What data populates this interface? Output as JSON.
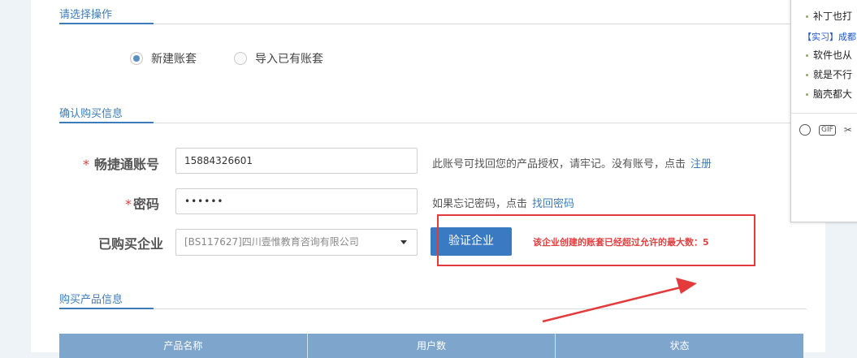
{
  "sections": {
    "select_operation": "请选择操作",
    "confirm_purchase": "确认购买信息",
    "purchase_product": "购买产品信息"
  },
  "radio_options": {
    "new_account_set": "新建账套",
    "import_account_set": "导入已有账套",
    "selected": "新建账套"
  },
  "form": {
    "account_label": "畅捷通账号",
    "account_value": "15884326601",
    "account_hint": "此账号可找回您的产品授权，请牢记。没有账号，点击",
    "account_hint_link": "注册",
    "password_label": "密码",
    "password_value": "••••••",
    "password_hint": "如果忘记密码，点击",
    "password_hint_link": "找回密码",
    "company_label": "已购买企业",
    "company_value": "[BS117627]四川壹惟教育咨询有限公司",
    "required_mark": "*",
    "verify_button": "验证企业",
    "error_message": "该企业创建的账套已经超过允许的最大数：5"
  },
  "table": {
    "headers": [
      "产品名称",
      "用户数",
      "状态"
    ]
  },
  "chat": {
    "lines": [
      "补丁也打",
      "【实习】成都",
      "软件也从",
      "就是不行",
      "脑壳都大"
    ],
    "tool_gif": "GIF"
  },
  "colors": {
    "accent": "#3d7cb8",
    "button": "#3a7ac3",
    "error": "#e04141",
    "annotation": "#e33b3b",
    "table_header": "#7ea5cc"
  }
}
